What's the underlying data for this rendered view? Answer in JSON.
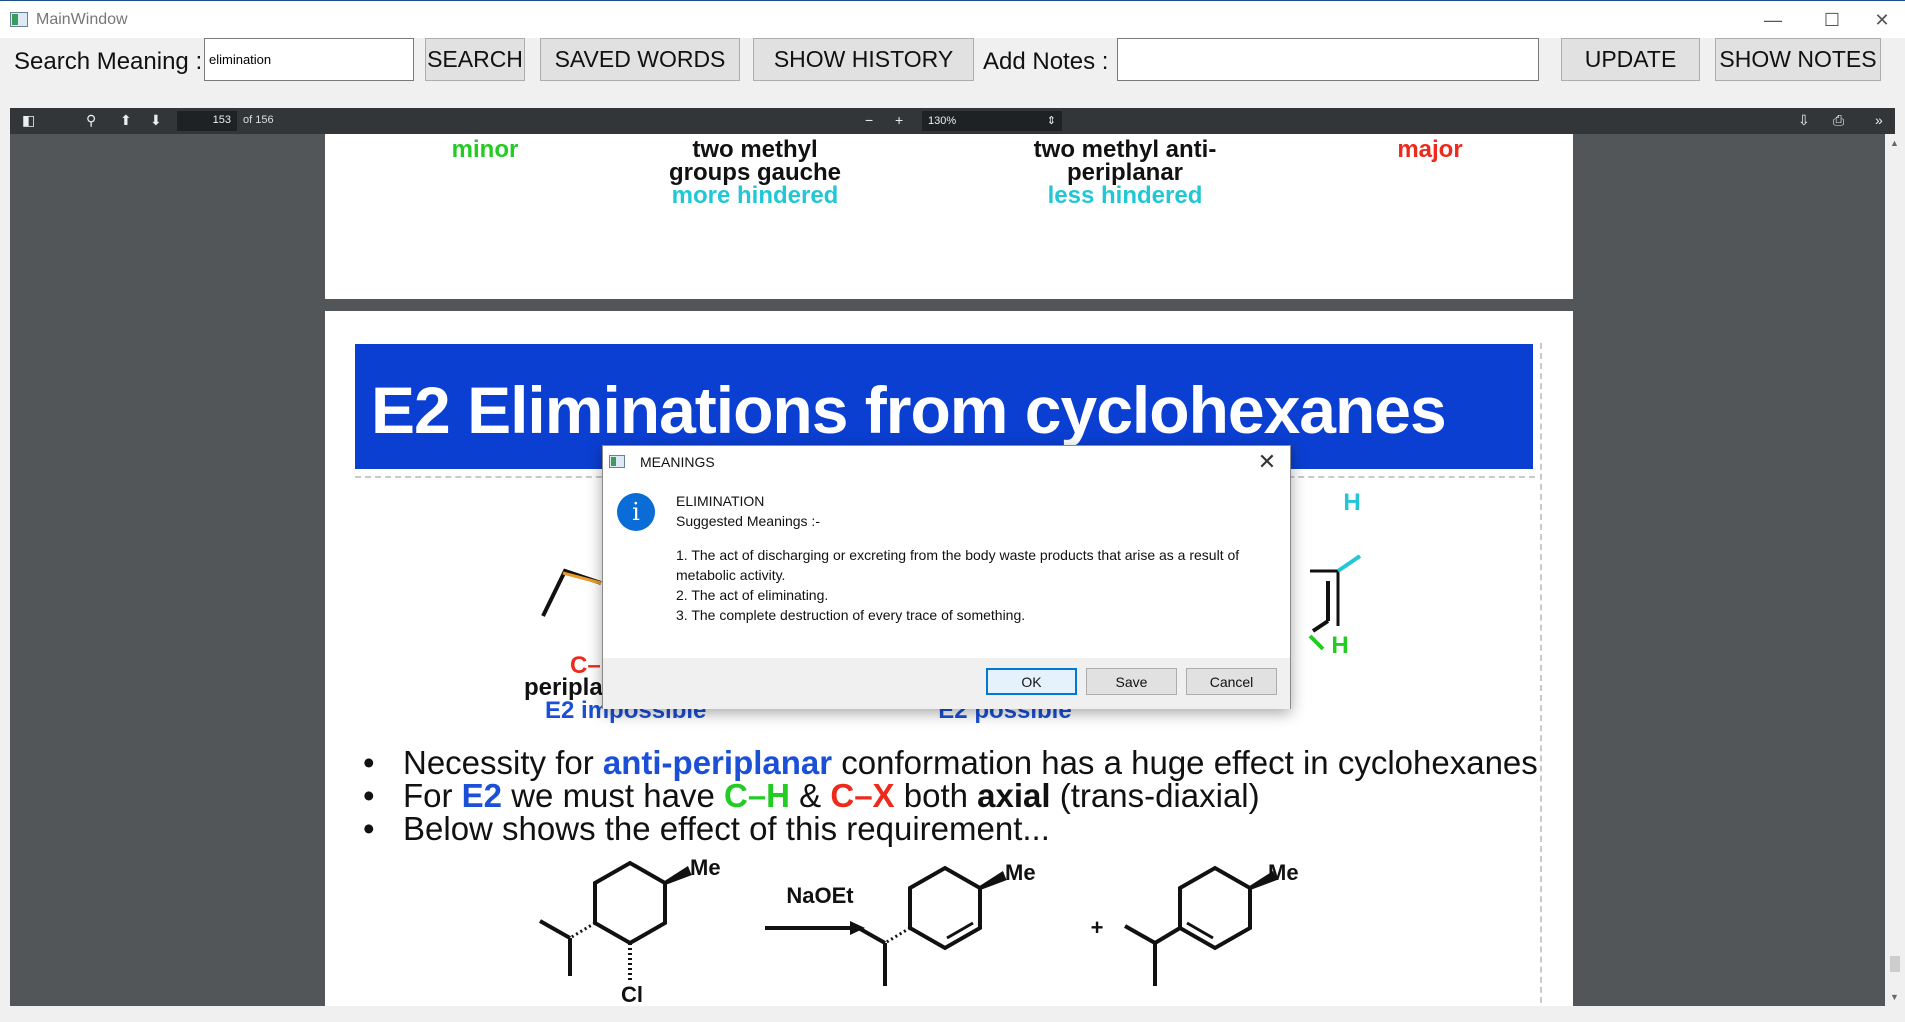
{
  "window": {
    "title": "MainWindow",
    "minimize_glyph": "—",
    "maximize_glyph": "☐",
    "close_glyph": "✕"
  },
  "toolbar": {
    "search_label": "Search Meaning :",
    "search_value": "elimination",
    "search_button": "SEARCH",
    "saved_words_button": "SAVED WORDS",
    "show_history_button": "SHOW HISTORY",
    "add_notes_label": "Add Notes :",
    "notes_value": "",
    "update_button": "UPDATE",
    "show_notes_button": "SHOW NOTES"
  },
  "pdf_toolbar": {
    "current_page": "153",
    "page_total": "of 156",
    "zoom": "130%"
  },
  "page1": {
    "minor": "minor",
    "left_title_1": "two methyl",
    "left_title_2": "groups gauche",
    "left_note": "more hindered",
    "right_title_1": "two methyl anti-",
    "right_title_2": "periplanar",
    "right_note": "less hindered",
    "major": "major"
  },
  "page2": {
    "banner_title": "E2 Eliminations from cyclohexanes",
    "label_h_top": "H",
    "label_h_bottom": "H",
    "label_cx": "C–",
    "label_peripl": "peripla",
    "label_e2_impossible": "E2 impossible",
    "label_e2_possible": "E2 possible",
    "bullets": [
      [
        "Necessity for ",
        "anti-periplanar",
        " conformation has a huge effect in cyclohexanes"
      ],
      [
        "For ",
        "E2",
        " we must have ",
        "C–H",
        " & ",
        "C–X",
        " both ",
        "axial",
        " (trans-diaxial)"
      ],
      [
        "Below shows the effect of this requirement..."
      ]
    ],
    "reagent": "NaOEt",
    "me_1": "Me",
    "me_2": "Me",
    "me_3": "Me",
    "cl": "Cl",
    "plus": "+"
  },
  "dialog": {
    "title": "MEANINGS",
    "word": "ELIMINATION",
    "suggested": "Suggested Meanings :-",
    "meaning_1": "1. The act of discharging or excreting from the body waste products that arise as a result of metabolic activity.",
    "meaning_2": "2. The act of eliminating.",
    "meaning_3": "3. The complete destruction of every trace of something.",
    "ok": "OK",
    "save": "Save",
    "cancel": "Cancel",
    "info_glyph": "i",
    "close_glyph": "✕"
  },
  "colors": {
    "green": "#22cc22",
    "red": "#ee2a1c",
    "cyan": "#22c7d6",
    "blue": "#1a4fd6",
    "banner": "#0b3fd1"
  }
}
